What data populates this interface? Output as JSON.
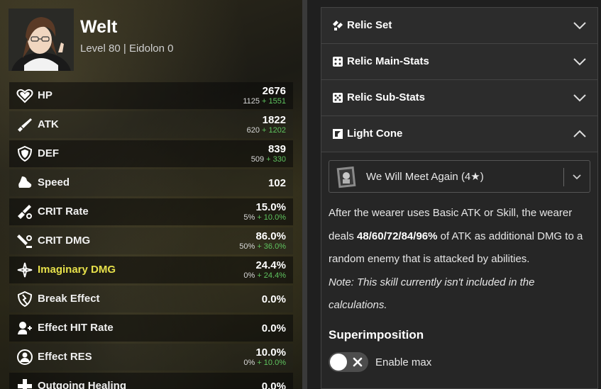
{
  "character": {
    "name": "Welt",
    "subtitle": "Level 80 | Eidolon 0"
  },
  "stats": [
    {
      "label": "HP",
      "icon": "hp-heart-icon",
      "value": "2676",
      "base": "1125",
      "bonus": "+ 1551"
    },
    {
      "label": "ATK",
      "icon": "atk-sword-icon",
      "value": "1822",
      "base": "620",
      "bonus": "+ 1202"
    },
    {
      "label": "DEF",
      "icon": "def-shield-icon",
      "value": "839",
      "base": "509",
      "bonus": "+ 330"
    },
    {
      "label": "Speed",
      "icon": "speed-boot-icon",
      "value": "102",
      "base": "",
      "bonus": ""
    },
    {
      "label": "CRIT Rate",
      "icon": "crit-rate-icon",
      "value": "15.0%",
      "base": "5%",
      "bonus": "+ 10.0%"
    },
    {
      "label": "CRIT DMG",
      "icon": "crit-dmg-icon",
      "value": "86.0%",
      "base": "50%",
      "bonus": "+ 36.0%"
    },
    {
      "label": "Imaginary DMG",
      "icon": "imaginary-dmg-icon",
      "value": "24.4%",
      "base": "0%",
      "bonus": "+ 24.4%"
    },
    {
      "label": "Break Effect",
      "icon": "break-effect-icon",
      "value": "0.0%",
      "base": "",
      "bonus": ""
    },
    {
      "label": "Effect HIT Rate",
      "icon": "effect-hit-icon",
      "value": "0.0%",
      "base": "",
      "bonus": ""
    },
    {
      "label": "Effect RES",
      "icon": "effect-res-icon",
      "value": "10.0%",
      "base": "0%",
      "bonus": "+ 10.0%"
    },
    {
      "label": "Outgoing Healing",
      "icon": "healing-icon",
      "value": "0.0%",
      "base": "",
      "bonus": ""
    }
  ],
  "accordions": {
    "relic_set": "Relic Set",
    "relic_main": "Relic Main-Stats",
    "relic_sub": "Relic Sub-Stats",
    "light_cone": "Light Cone"
  },
  "light_cone": {
    "selected": "We Will Meet Again (4★)",
    "desc_part1": "After the wearer uses Basic ATK or Skill, the wearer deals ",
    "desc_bold": "48/60/72/84/96%",
    "desc_part2": " of ATK as additional DMG to a random enemy that is attacked by abilities.",
    "note": "Note: This skill currently isn't included in the calculations.",
    "superimposition_title": "Superimposition",
    "toggle_label": "Enable max",
    "toggle_on": false
  },
  "colors": {
    "imaginary": "#e6e04a",
    "bonus": "#5fc45f"
  }
}
